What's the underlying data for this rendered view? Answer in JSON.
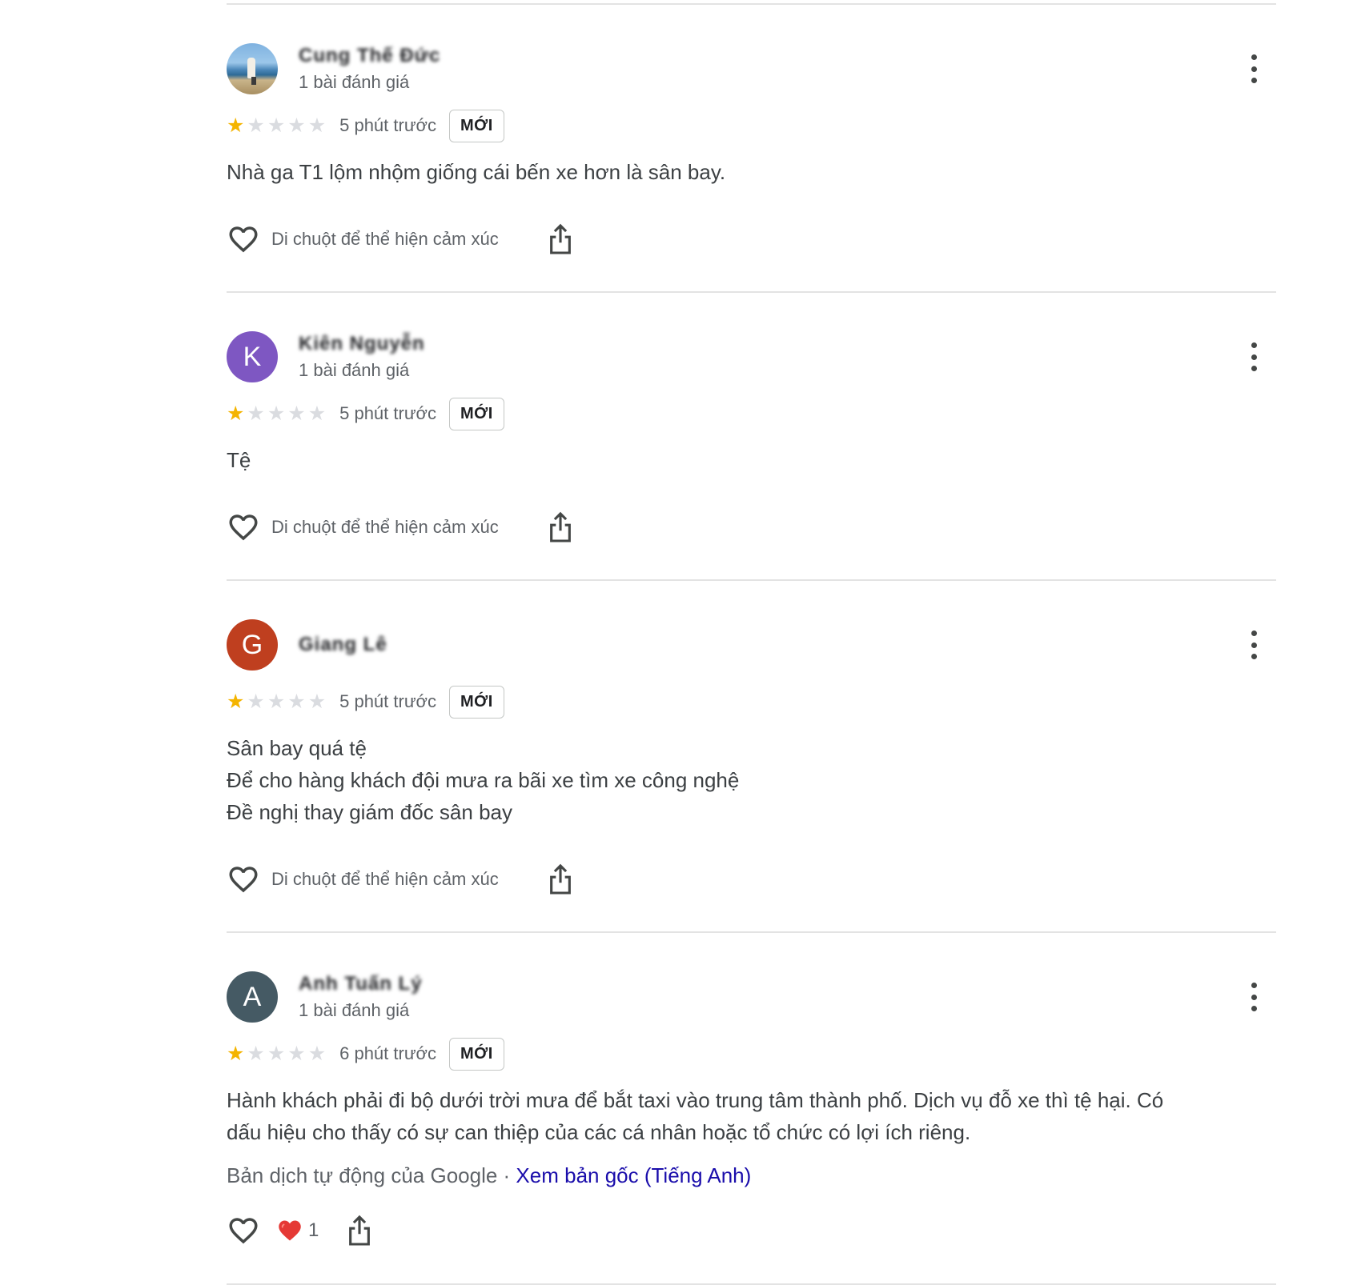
{
  "colors": {
    "star_filled": "#f4b400",
    "star_empty": "#dadce0",
    "link": "#1a0dab"
  },
  "reviews": [
    {
      "author": "Cung Thế Đức",
      "review_count": "1 bài đánh giá",
      "avatar": {
        "type": "photo",
        "letter": "",
        "color": ""
      },
      "rating": 1,
      "time": "5 phút trước",
      "badge": "MỚI",
      "text_lines": [
        "Nhà ga T1 lộm nhộm giống cái bến xe hơn là sân bay."
      ],
      "react_hint": "Di chuột để thể hiện cảm xúc"
    },
    {
      "author": "Kiên Nguyễn",
      "review_count": "1 bài đánh giá",
      "avatar": {
        "type": "letter",
        "letter": "K",
        "color": "#7e57c2"
      },
      "rating": 1,
      "time": "5 phút trước",
      "badge": "MỚI",
      "text_lines": [
        "Tệ"
      ],
      "react_hint": "Di chuột để thể hiện cảm xúc"
    },
    {
      "author": "Giang Lê",
      "review_count": "",
      "avatar": {
        "type": "letter",
        "letter": "G",
        "color": "#bf3f1f"
      },
      "rating": 1,
      "time": "5 phút trước",
      "badge": "MỚI",
      "text_lines": [
        "Sân bay quá tệ",
        "Để cho hàng khách đội mưa ra bãi xe tìm xe công nghệ",
        "Đề nghị thay giám đốc sân bay"
      ],
      "react_hint": "Di chuột để thể hiện cảm xúc"
    },
    {
      "author": "Anh Tuấn Lý",
      "review_count": "1 bài đánh giá",
      "avatar": {
        "type": "letter",
        "letter": "A",
        "color": "#455a64"
      },
      "rating": 1,
      "time": "6 phút trước",
      "badge": "MỚI",
      "text_lines": [
        "Hành khách phải đi bộ dưới trời mưa để bắt taxi vào trung tâm thành phố. Dịch vụ đỗ xe thì tệ hại. Có",
        "dấu hiệu cho thấy có sự can thiệp của các cá nhân hoặc tổ chức có lợi ích riêng."
      ],
      "translation": {
        "prefix": "Bản dịch tự động của Google",
        "separator": " · ",
        "link": "Xem bản gốc (Tiếng Anh)"
      },
      "reaction": {
        "emoji": "heart",
        "count": "1"
      }
    }
  ]
}
